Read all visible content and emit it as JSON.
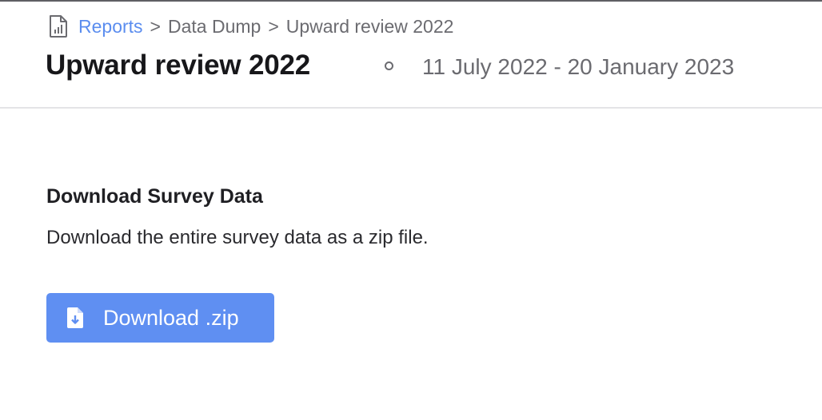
{
  "breadcrumb": {
    "icon": "report-chart-icon",
    "items": [
      {
        "label": "Reports",
        "link": true
      },
      {
        "label": "Data Dump",
        "link": false
      },
      {
        "label": "Upward review 2022",
        "link": false
      }
    ],
    "separator": ">"
  },
  "header": {
    "title": "Upward review 2022",
    "status_icon": "circle-outline-icon",
    "date_range": "11 July 2022 - 20 January 2023"
  },
  "section": {
    "title": "Download Survey Data",
    "description": "Download the entire survey data as a zip file."
  },
  "download_button": {
    "label": "Download .zip",
    "icon": "file-download-icon"
  },
  "colors": {
    "accent": "#5f8ff2",
    "link": "#5b8def",
    "muted_text": "#6b6b70",
    "divider": "#e4e4e7"
  }
}
